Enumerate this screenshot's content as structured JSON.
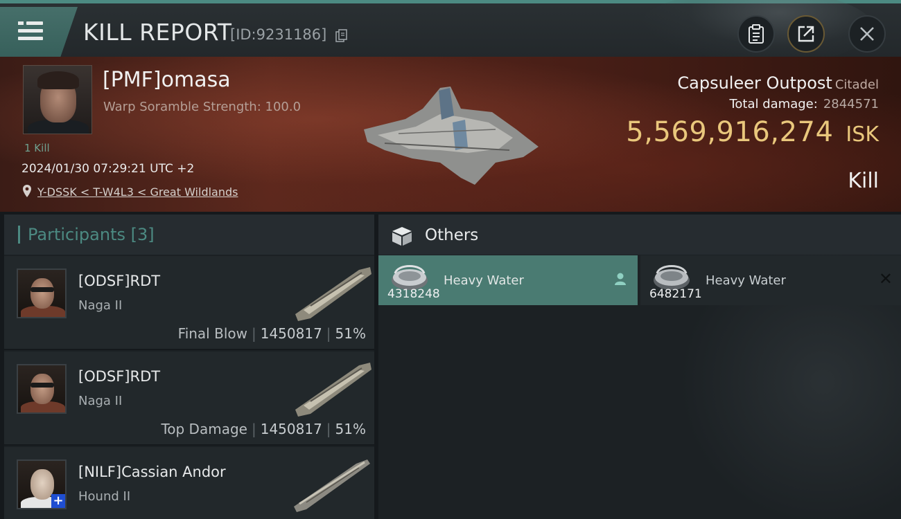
{
  "header": {
    "title": "KILL REPORT",
    "report_id": "[ID:9231186]",
    "icons": [
      "menu-icon",
      "copy-icon",
      "clipboard-icon",
      "share-icon",
      "close-icon"
    ]
  },
  "victim": {
    "name": "[PMF]omasa",
    "subtitle": "Warp Soramble Strength: 100.0",
    "kill_count": "1 Kill",
    "datetime": "2024/01/30 07:29:21 UTC +2",
    "location": "Y-DSSK < T-W4L3 < Great Wildlands",
    "ship_name": "Capsuleer Outpost",
    "ship_class": "Citadel",
    "total_damage_label": "Total damage:",
    "total_damage": "2844571",
    "isk_value": "5,569,916,274",
    "isk_unit": "ISK",
    "result": "Kill"
  },
  "participants": {
    "header": "Participants [3]",
    "rows": [
      {
        "name": "[ODSF]RDT",
        "ship": "Naga II",
        "label": "Final Blow",
        "damage": "1450817",
        "percent": "51%"
      },
      {
        "name": "[ODSF]RDT",
        "ship": "Naga II",
        "label": "Top Damage",
        "damage": "1450817",
        "percent": "51%"
      },
      {
        "name": "[NILF]Cassian Andor",
        "ship": "Hound II",
        "label": "",
        "damage": "",
        "percent": ""
      }
    ]
  },
  "others": {
    "header": "Others",
    "items": [
      {
        "name": "Heavy Water",
        "quantity": "4318248",
        "selected": true
      },
      {
        "name": "Heavy Water",
        "quantity": "6482171",
        "selected": false
      }
    ]
  },
  "colors": {
    "accent": "#4c8a82",
    "isk_gold": "#e9c77c",
    "banner_red": "#5b281d"
  }
}
